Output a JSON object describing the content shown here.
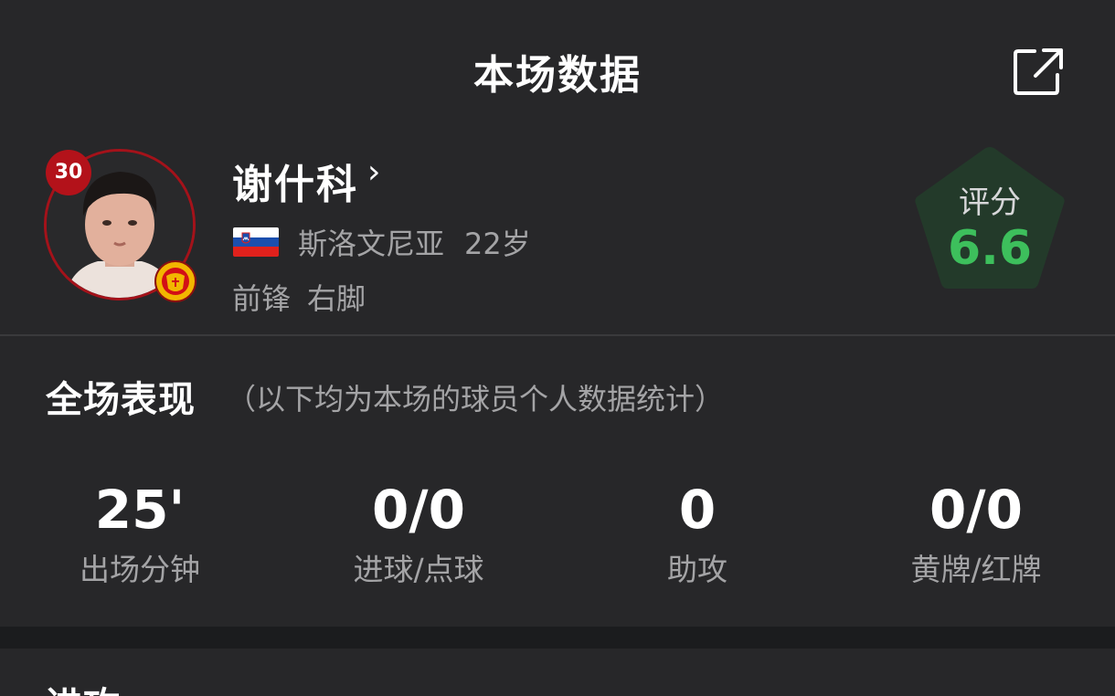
{
  "header": {
    "title": "本场数据",
    "share_icon": "share-external-icon"
  },
  "player": {
    "number": "30",
    "name": "谢什科",
    "chevron": "›",
    "nationality": "斯洛文尼亚",
    "age": "22岁",
    "position": "前锋",
    "foot": "右脚",
    "flag_icon": "slovenia-flag-icon",
    "club_icon": "club-crest-icon",
    "badge_color": "#b3121a"
  },
  "rating": {
    "label": "评分",
    "value": "6.6",
    "color": "#3dbf5c",
    "background": "#233a2a"
  },
  "performance": {
    "title": "全场表现",
    "subtitle": "（以下均为本场的球员个人数据统计）",
    "stats": [
      {
        "value": "25'",
        "label": "出场分钟"
      },
      {
        "value": "0/0",
        "label": "进球/点球"
      },
      {
        "value": "0",
        "label": "助攻"
      },
      {
        "value": "0/0",
        "label": "黄牌/红牌"
      }
    ]
  },
  "next_section": {
    "title": "进攻"
  }
}
